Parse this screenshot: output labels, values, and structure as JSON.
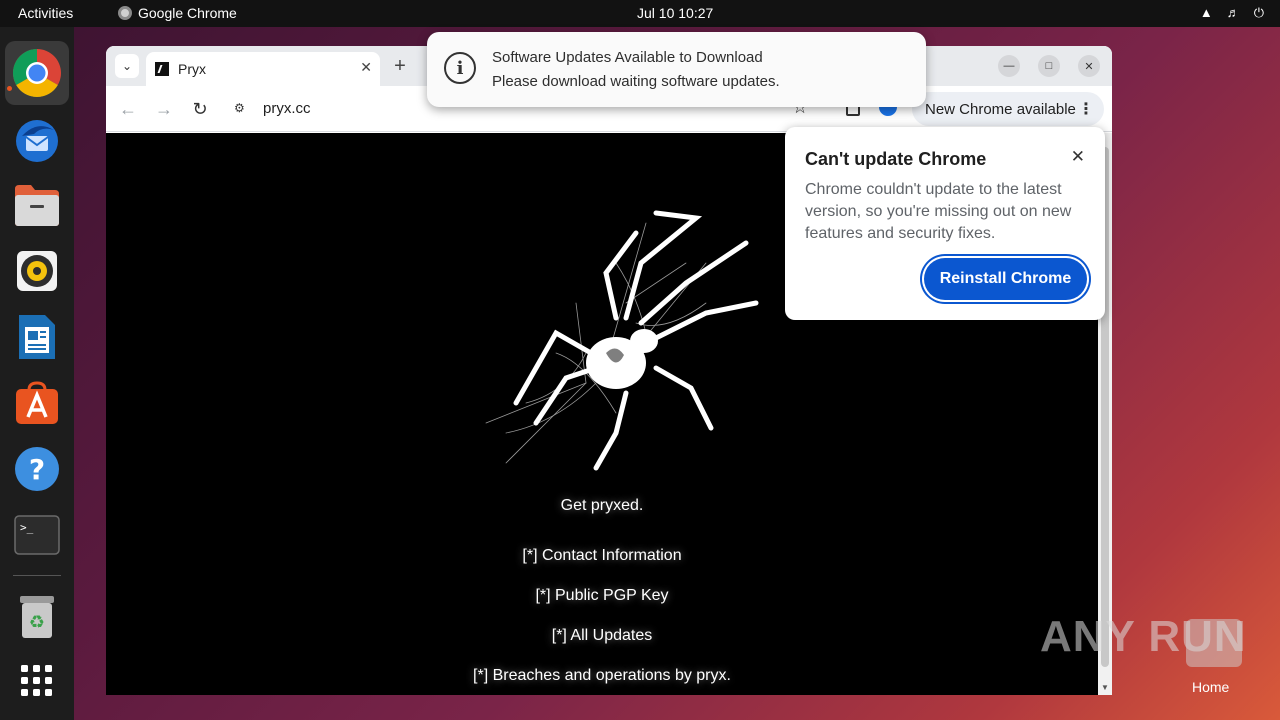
{
  "topbar": {
    "activities": "Activities",
    "app_name": "Google Chrome",
    "clock": "Jul 10  10:27"
  },
  "dock": {
    "items": [
      "chrome-icon",
      "thunderbird-icon",
      "files-icon",
      "rhythmbox-icon",
      "writer-icon",
      "app-center-icon",
      "help-icon",
      "terminal-icon",
      "trash-icon",
      "show-apps-icon"
    ]
  },
  "browser": {
    "tab_title": "Pryx",
    "url": "pryx.cc",
    "new_chrome_label": "New Chrome available"
  },
  "notification": {
    "title": "Software Updates Available to Download",
    "body": "Please download waiting software updates."
  },
  "popup": {
    "title": "Can't update Chrome",
    "body": "Chrome couldn't update to the latest version, so you're missing out on new features and security fixes.",
    "button": "Reinstall Chrome"
  },
  "page": {
    "tagline": "Get pryxed.",
    "links": [
      "[*] Contact Information",
      "[*] Public PGP Key",
      "[*] All Updates",
      "[*] Breaches and operations by pryx."
    ]
  },
  "watermark": "ANY RUN",
  "desktop": {
    "home_label": "Home"
  }
}
